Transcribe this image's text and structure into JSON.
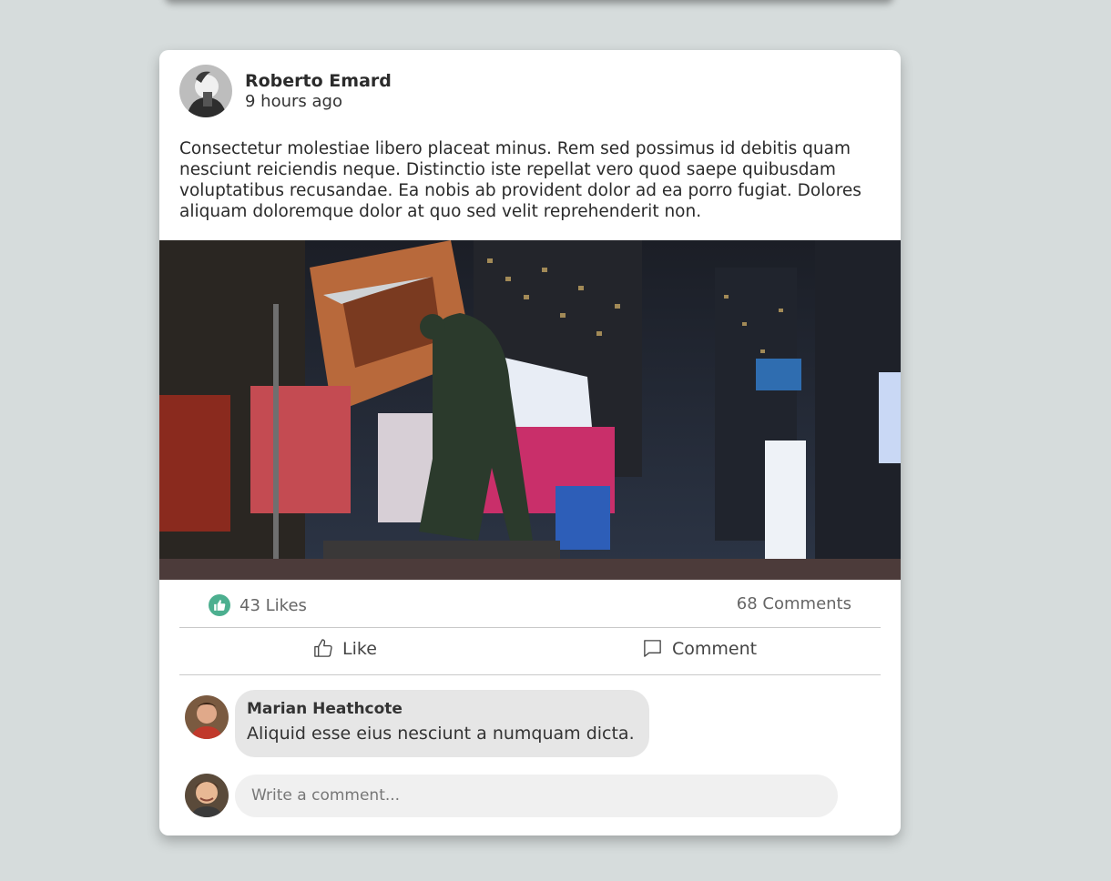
{
  "post": {
    "author": "Roberto Emard",
    "time": "9 hours ago",
    "body": "Consectetur molestiae libero placeat minus. Rem sed possimus id debitis quam nesciunt reiciendis neque. Distinctio iste repellat vero quod saepe quibusdam voluptatibus recusandae. Ea nobis ab provident dolor ad ea porro fugiat. Dolores aliquam doloremque dolor at quo sed velit reprehenderit non.",
    "image_description": "",
    "likes_label": "43 Likes",
    "comments_label": "68 Comments"
  },
  "actions": {
    "like_label": "Like",
    "comment_label": "Comment"
  },
  "comments": [
    {
      "author": "Marian Heathcote",
      "text": "Aliquid esse eius nesciunt a numquam dicta."
    }
  ],
  "composer": {
    "placeholder": "Write a comment..."
  },
  "colors": {
    "page_background": "#d6dcdc",
    "like_badge": "#4caf8f"
  }
}
